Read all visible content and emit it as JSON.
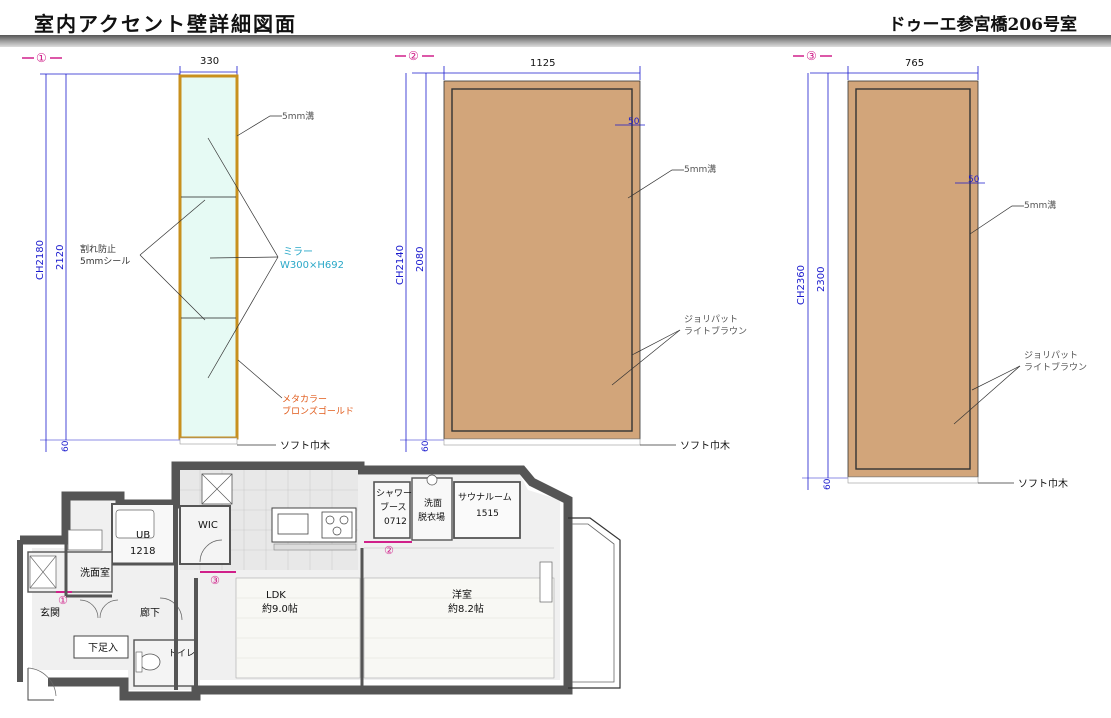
{
  "header": {
    "title": "室内アクセント壁詳細図面",
    "room": "ドゥーエ参宮橋206号室"
  },
  "elevation1": {
    "marker": "①",
    "width": "330",
    "ch": "CH2180",
    "height": "2120",
    "base": "60",
    "note_groove": "5mm溝",
    "note_crack_1": "割れ防止",
    "note_crack_2": "5mmシール",
    "note_mirror_1": "ミラー",
    "note_mirror_2": "W300×H692",
    "note_frame_1": "メタカラー",
    "note_frame_2": "ブロンズゴールド",
    "note_skirting": "ソフト巾木"
  },
  "elevation2": {
    "marker": "②",
    "width": "1125",
    "ch": "CH2140",
    "height": "2080",
    "base": "60",
    "inset": "50",
    "note_groove": "5mm溝",
    "note_finish_1": "ジョリパット",
    "note_finish_2": "ライトブラウン",
    "note_skirting": "ソフト巾木"
  },
  "elevation3": {
    "marker": "③",
    "width": "765",
    "ch": "CH2360",
    "height": "2300",
    "base": "60",
    "inset": "50",
    "note_groove": "5mm溝",
    "note_finish_1": "ジョリパット",
    "note_finish_2": "ライトブラウン",
    "note_skirting": "ソフト巾木"
  },
  "floorplan": {
    "shower_1": "シャワー",
    "shower_2": "ブース",
    "shower_3": "0712",
    "wash_1": "洗面",
    "wash_2": "脱衣場",
    "sauna_1": "サウナルーム",
    "sauna_2": "1515",
    "ub_1": "UB",
    "ub_2": "1218",
    "wic": "WIC",
    "washroom": "洗面室",
    "entrance": "玄関",
    "hall": "廊下",
    "shoes": "下足入",
    "toilet": "トイレ",
    "ldk_1": "LDK",
    "ldk_2": "約9.0帖",
    "western_1": "洋室",
    "western_2": "約8.2帖",
    "mark_1": "①",
    "mark_2": "②",
    "mark_3": "③"
  },
  "colors": {
    "dimension": "#1a1acd",
    "callout_mirror": "#2aa8c8",
    "callout_frame": "#e05a1a",
    "marker": "#d0208a",
    "mirror_fill": "#e6faf4",
    "frame": "#c8901e",
    "wall_finish": "#d2a57a"
  }
}
